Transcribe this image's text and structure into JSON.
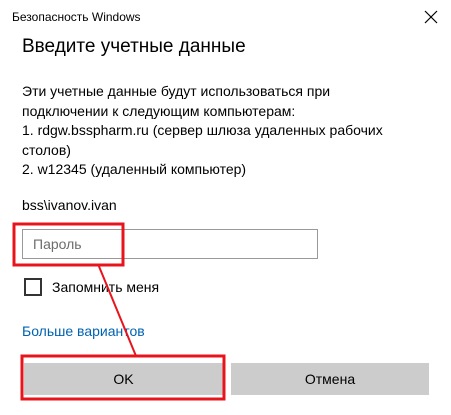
{
  "window": {
    "title": "Безопасность Windows",
    "close_icon": "close-icon"
  },
  "dialog": {
    "heading": "Введите учетные данные",
    "message_lines": [
      "Эти учетные данные будут использоваться при",
      "подключении к следующим компьютерам:",
      "1. rdgw.bsspharm.ru (сервер шлюза удаленных рабочих",
      "столов)",
      "2. w12345 (удаленный компьютер)"
    ],
    "username": "bss\\ivanov.ivan",
    "password": {
      "placeholder": "Пароль",
      "value": ""
    },
    "remember": {
      "label": "Запомнить меня",
      "checked": false
    },
    "more_options_link": "Больше вариантов",
    "buttons": {
      "ok": "OK",
      "cancel": "Отмена"
    }
  },
  "colors": {
    "link": "#0063b1",
    "button_bg": "#cccccc",
    "annotation": "#e8141c"
  }
}
